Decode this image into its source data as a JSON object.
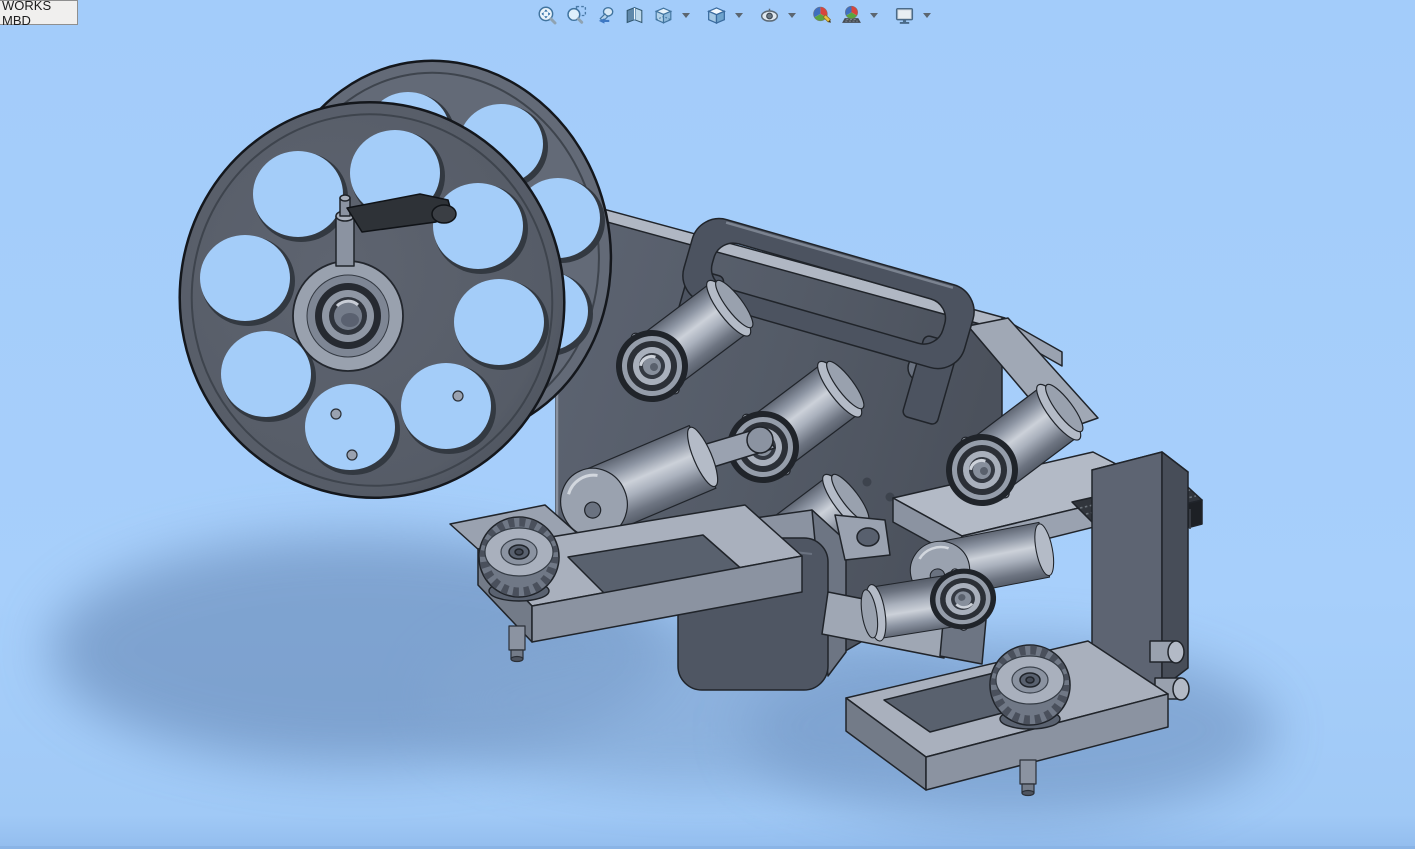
{
  "tab": {
    "label": "WORKS MBD"
  },
  "toolbar": {
    "items": [
      {
        "name": "zoom-to-fit"
      },
      {
        "name": "zoom-to-area"
      },
      {
        "name": "previous-view"
      },
      {
        "name": "section-view"
      },
      {
        "name": "view-orientation",
        "has_dropdown": true
      },
      {
        "name": "display-style",
        "has_dropdown": true
      },
      {
        "name": "hide-show-items",
        "has_dropdown": true
      },
      {
        "name": "edit-appearance",
        "has_dropdown": false
      },
      {
        "name": "apply-scene",
        "has_dropdown": true
      },
      {
        "name": "view-settings",
        "has_dropdown": true
      }
    ]
  },
  "viewport": {
    "background_top": "#a3ccfa",
    "background_bottom": "#93bdee",
    "bottom_edge_color": "#8ab4e6",
    "shadow_color": "#5f80ae"
  },
  "model": {
    "parts": [
      "spool-reel",
      "crank-handle",
      "hub-bearing",
      "frame-plate",
      "top-rail",
      "carry-handle",
      "guide-rollers",
      "swing-arm",
      "motor-block",
      "shelf-plate",
      "grip-pad",
      "right-block",
      "left-base-plate",
      "right-base-plate",
      "adjustment-knob-left",
      "adjustment-knob-right",
      "foot-pin-left",
      "foot-pin-right"
    ],
    "colors": {
      "dark_grey": "#555c68",
      "mid_grey": "#7e8694",
      "light_grey": "#a9b0bd",
      "outline": "#20242a"
    }
  }
}
